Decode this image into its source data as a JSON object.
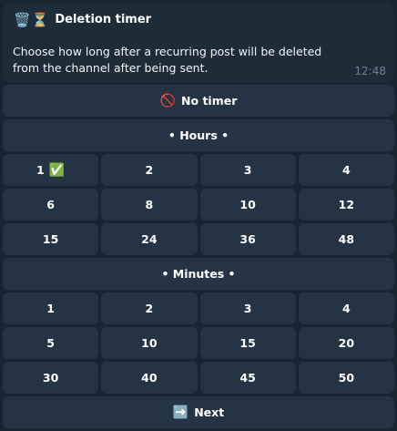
{
  "message": {
    "title_icons": "🗑️⏳",
    "title": "Deletion timer",
    "text": "Choose how long after a recurring post will be deleted from the channel after being sent.",
    "time": "12:48"
  },
  "keyboard": {
    "no_timer": {
      "icon": "🚫",
      "label": "No timer"
    },
    "hours_header": "• Hours •",
    "hours": [
      {
        "label": "1",
        "selected_icon": "✅"
      },
      {
        "label": "2"
      },
      {
        "label": "3"
      },
      {
        "label": "4"
      },
      {
        "label": "6"
      },
      {
        "label": "8"
      },
      {
        "label": "10"
      },
      {
        "label": "12"
      },
      {
        "label": "15"
      },
      {
        "label": "24"
      },
      {
        "label": "36"
      },
      {
        "label": "48"
      }
    ],
    "minutes_header": "• Minutes •",
    "minutes": [
      {
        "label": "1"
      },
      {
        "label": "2"
      },
      {
        "label": "3"
      },
      {
        "label": "4"
      },
      {
        "label": "5"
      },
      {
        "label": "10"
      },
      {
        "label": "15"
      },
      {
        "label": "20"
      },
      {
        "label": "30"
      },
      {
        "label": "40"
      },
      {
        "label": "45"
      },
      {
        "label": "50"
      }
    ],
    "next": {
      "icon": "➡️",
      "label": "Next"
    }
  }
}
